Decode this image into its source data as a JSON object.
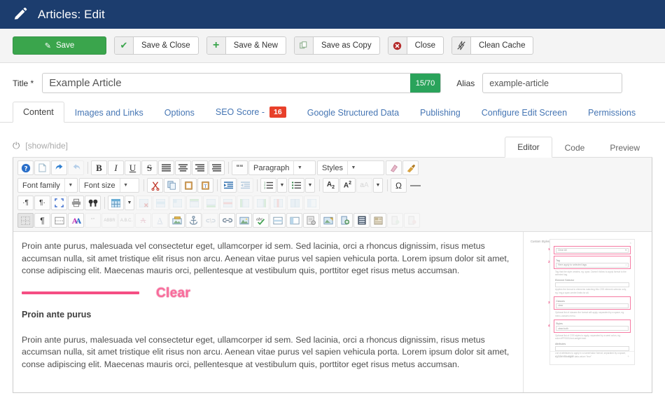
{
  "header": {
    "title": "Articles: Edit",
    "icon": "pencil-icon",
    "bg_color": "#1c3d6e"
  },
  "toolbar": {
    "buttons": [
      {
        "label": "Save",
        "icon": "save-pencil-icon",
        "style": "primary",
        "color": "#3aa54c"
      },
      {
        "label": "Save & Close",
        "icon": "check-icon"
      },
      {
        "label": "Save & New",
        "icon": "plus-icon"
      },
      {
        "label": "Save as Copy",
        "icon": "copy-icon"
      },
      {
        "label": "Close",
        "icon": "close-circle-icon"
      },
      {
        "label": "Clean Cache",
        "icon": "flash-off-icon"
      }
    ]
  },
  "form": {
    "title_label": "Title *",
    "title_value": "Example Article",
    "title_placeholder": "Title",
    "counter": "15/70",
    "counter_color": "#2aa35b",
    "alias_label": "Alias",
    "alias_value": "example-article",
    "alias_placeholder": "example-article"
  },
  "tabs": [
    {
      "label": "Content",
      "active": true
    },
    {
      "label": "Images and Links",
      "active": false
    },
    {
      "label": "Options",
      "active": false
    },
    {
      "label": "SEO Score -",
      "active": false,
      "badge": "16",
      "badge_color": "#e8402a"
    },
    {
      "label": "Google Structured Data",
      "active": false
    },
    {
      "label": "Publishing",
      "active": false
    },
    {
      "label": "Configure Edit Screen",
      "active": false
    },
    {
      "label": "Permissions",
      "active": false
    }
  ],
  "editor": {
    "toggle_label": "[show/hide]",
    "toggle_icon": "power-icon",
    "modes": [
      {
        "label": "Editor",
        "active": true
      },
      {
        "label": "Code",
        "active": false
      },
      {
        "label": "Preview",
        "active": false
      }
    ],
    "selects": {
      "paragraph": "Paragraph",
      "styles": "Styles",
      "font_family": "Font family",
      "font_size": "Font size"
    },
    "row1_icons": [
      "help-icon",
      "new-document-icon",
      "undo-icon",
      "redo-icon",
      "bold-icon",
      "italic-icon",
      "underline-icon",
      "strikethrough-icon",
      "align-left-icon",
      "align-center-icon",
      "align-right-icon",
      "align-justify-icon",
      "blockquote-icon",
      "remove-format-icon",
      "clean-format-icon"
    ],
    "row2_icons": [
      "cut-icon",
      "copy-icon",
      "paste-icon",
      "paste-text-icon",
      "outdent-icon",
      "indent-icon",
      "numbered-list-icon",
      "bullet-list-icon",
      "subscript-icon",
      "superscript-icon",
      "text-color-icon",
      "special-character-icon",
      "horizontal-rule-icon"
    ],
    "row3_icons": [
      "ltr-icon",
      "rtl-icon",
      "fullscreen-icon",
      "print-icon",
      "search-replace-icon",
      "table-icon",
      "delete-table-icon",
      "table-row-props-icon",
      "table-cell-props-icon",
      "insert-row-before-icon",
      "insert-row-after-icon",
      "delete-row-icon",
      "delete-column-icon",
      "insert-column-before-icon",
      "insert-column-after-icon",
      "merge-cells-icon",
      "split-cells-icon",
      "table-grid-icon",
      "table-caption-icon"
    ],
    "row4_icons": [
      "visual-blocks-icon",
      "paragraph-mark-icon",
      "page-break-icon",
      "spellcheck-icon",
      "quote-icon",
      "abbr-icon",
      "acronym-icon",
      "del-icon",
      "ins-icon",
      "insert-image-icon",
      "anchor-icon",
      "unlink-icon",
      "link-icon",
      "unlink2-icon",
      "image-icon",
      "spellchecker-icon",
      "readmore-icon",
      "pagebreak-icon",
      "template-icon",
      "media-icon",
      "article-icon",
      "module-icon",
      "layout-icon",
      "contact-icon",
      "toggle-icon"
    ]
  },
  "content": {
    "paragraph1": "Proin ante purus, malesuada vel consectetur eget, ullamcorper id sem. Sed lacinia, orci a rhoncus dignissim, risus metus accumsan nulla, sit amet tristique elit risus non arcu. Aenean vitae purus vel sapien vehicula porta. Lorem ipsum dolor sit amet, conse adipiscing elit. Maecenas mauris orci, pellentesque at vestibulum quis, porttitor eget risus metus accumsan.",
    "clear_label": "Clear",
    "clear_color": "#f96a9a",
    "divider_color": "#f54e83",
    "heading": "Proin ante purus",
    "paragraph2": "Proin ante purus, malesuada vel consectetur eget, ullamcorper id sem. Sed lacinia, orci a rhoncus dignissim, risus metus accumsan nulla, sit amet tristique elit risus non arcu. Aenean vitae purus vel sapien vehicula porta. Lorem ipsum dolor sit amet, conse adipiscing elit. Maecenas mauris orci, pellentesque at vestibulum quis, porttitor eget risus metus accumsan."
  },
  "thumbnail": {
    "panel_title": "Custom Styles",
    "highlight_color": "#f67ba3",
    "fields": [
      {
        "num": "1",
        "label": "",
        "value": "Clear All",
        "hint": "",
        "highlight": true
      },
      {
        "num": "2",
        "label": "Tag",
        "value": "Here apply to selected tags",
        "hint": "Tag that the style creates, eg. span. Doesn't follow to apply format to the selected tag.",
        "highlight": true
      },
      {
        "num": "",
        "label": "Element Selector",
        "value": "",
        "hint": "Applies the format to elements matching this CSS element selector only, eg. img,a span.center limits for all.",
        "highlight": false
      },
      {
        "num": "3",
        "label": "Classes",
        "value": "clear",
        "hint": "Optional list of classes the format will apply, separated by a space, eg. menu-classes menu.",
        "highlight": true
      },
      {
        "num": "4",
        "label": "Styles",
        "value": "clear:both",
        "hint": "Optional list of CSS styles to apply, separated by a semi colon, eg. color:#FF0000;font-weight:bold.",
        "highlight": true
      },
      {
        "num": "",
        "label": "Attributes",
        "value": "",
        "hint": "List of attributes to apply in a name/value format, separated by a space, eg. title=\"Example\" data-value=\"true\"",
        "highlight": false
      }
    ],
    "add_label": "Add new style...",
    "add_icon": "plus-icon",
    "close_icon": "close-icon"
  }
}
